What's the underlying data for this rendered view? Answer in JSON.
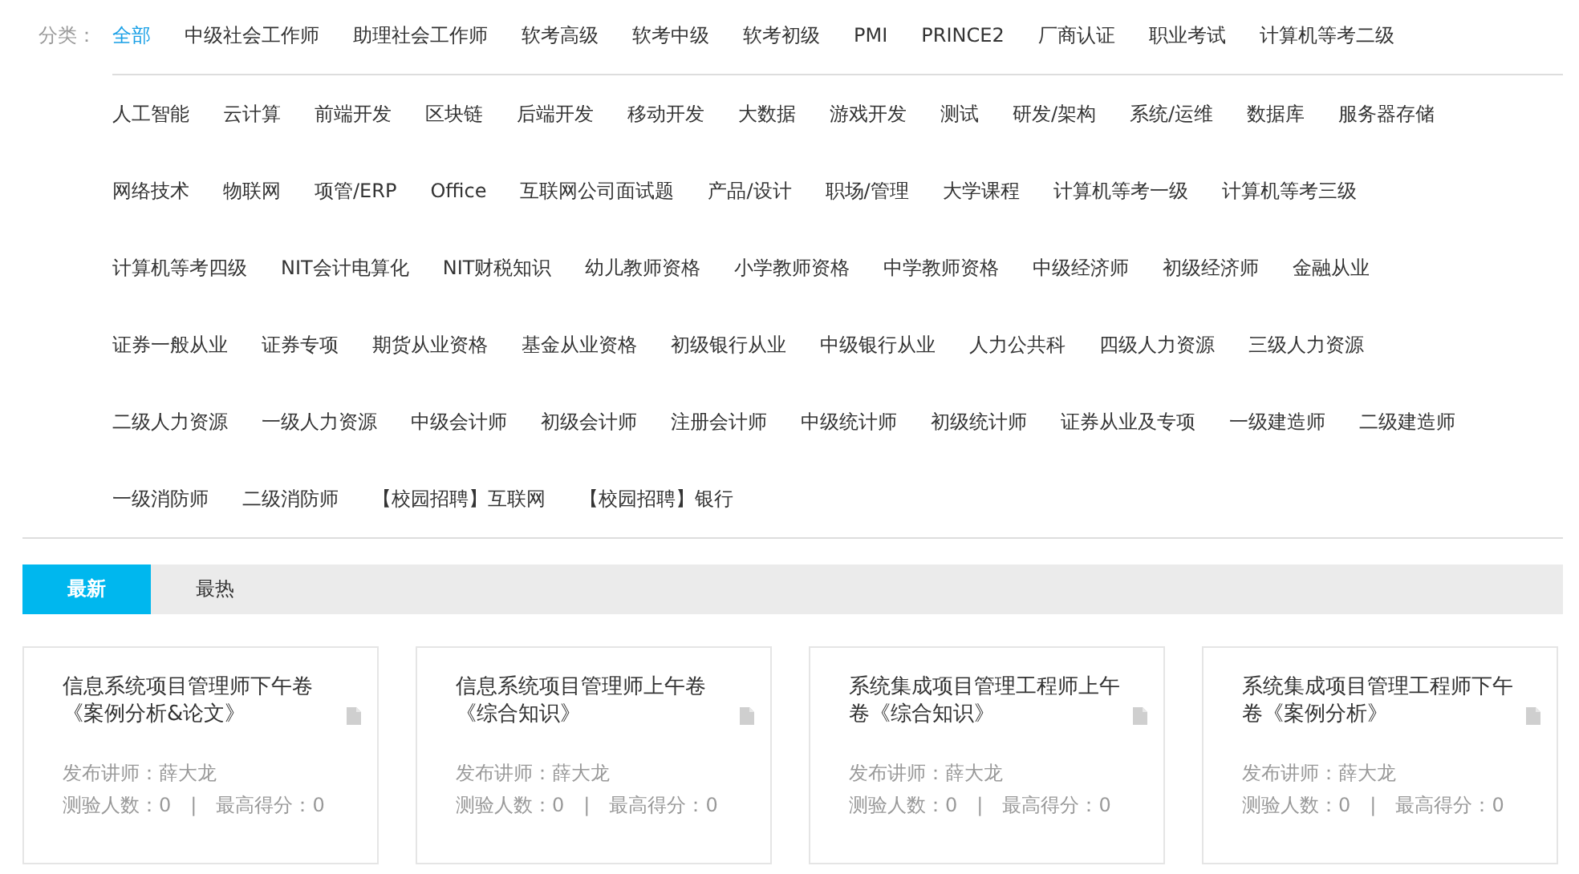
{
  "category_label": "分类：",
  "category_rows": [
    [
      {
        "label": "全部",
        "selected": true
      },
      {
        "label": "中级社会工作师",
        "selected": false
      },
      {
        "label": "助理社会工作师",
        "selected": false
      },
      {
        "label": "软考高级",
        "selected": false
      },
      {
        "label": "软考中级",
        "selected": false
      },
      {
        "label": "软考初级",
        "selected": false
      },
      {
        "label": "PMI",
        "selected": false
      },
      {
        "label": "PRINCE2",
        "selected": false
      },
      {
        "label": "厂商认证",
        "selected": false
      },
      {
        "label": "职业考试",
        "selected": false
      },
      {
        "label": "计算机等考二级",
        "selected": false
      }
    ],
    [
      {
        "label": "人工智能",
        "selected": false
      },
      {
        "label": "云计算",
        "selected": false
      },
      {
        "label": "前端开发",
        "selected": false
      },
      {
        "label": "区块链",
        "selected": false
      },
      {
        "label": "后端开发",
        "selected": false
      },
      {
        "label": "移动开发",
        "selected": false
      },
      {
        "label": "大数据",
        "selected": false
      },
      {
        "label": "游戏开发",
        "selected": false
      },
      {
        "label": "测试",
        "selected": false
      },
      {
        "label": "研发/架构",
        "selected": false
      },
      {
        "label": "系统/运维",
        "selected": false
      },
      {
        "label": "数据库",
        "selected": false
      },
      {
        "label": "服务器存储",
        "selected": false
      }
    ],
    [
      {
        "label": "网络技术",
        "selected": false
      },
      {
        "label": "物联网",
        "selected": false
      },
      {
        "label": "项管/ERP",
        "selected": false
      },
      {
        "label": "Office",
        "selected": false
      },
      {
        "label": "互联网公司面试题",
        "selected": false
      },
      {
        "label": "产品/设计",
        "selected": false
      },
      {
        "label": "职场/管理",
        "selected": false
      },
      {
        "label": "大学课程",
        "selected": false
      },
      {
        "label": "计算机等考一级",
        "selected": false
      },
      {
        "label": "计算机等考三级",
        "selected": false
      }
    ],
    [
      {
        "label": "计算机等考四级",
        "selected": false
      },
      {
        "label": "NIT会计电算化",
        "selected": false
      },
      {
        "label": "NIT财税知识",
        "selected": false
      },
      {
        "label": "幼儿教师资格",
        "selected": false
      },
      {
        "label": "小学教师资格",
        "selected": false
      },
      {
        "label": "中学教师资格",
        "selected": false
      },
      {
        "label": "中级经济师",
        "selected": false
      },
      {
        "label": "初级经济师",
        "selected": false
      },
      {
        "label": "金融从业",
        "selected": false
      }
    ],
    [
      {
        "label": "证券一般从业",
        "selected": false
      },
      {
        "label": "证券专项",
        "selected": false
      },
      {
        "label": "期货从业资格",
        "selected": false
      },
      {
        "label": "基金从业资格",
        "selected": false
      },
      {
        "label": "初级银行从业",
        "selected": false
      },
      {
        "label": "中级银行从业",
        "selected": false
      },
      {
        "label": "人力公共科",
        "selected": false
      },
      {
        "label": "四级人力资源",
        "selected": false
      },
      {
        "label": "三级人力资源",
        "selected": false
      }
    ],
    [
      {
        "label": "二级人力资源",
        "selected": false
      },
      {
        "label": "一级人力资源",
        "selected": false
      },
      {
        "label": "中级会计师",
        "selected": false
      },
      {
        "label": "初级会计师",
        "selected": false
      },
      {
        "label": "注册会计师",
        "selected": false
      },
      {
        "label": "中级统计师",
        "selected": false
      },
      {
        "label": "初级统计师",
        "selected": false
      },
      {
        "label": "证券从业及专项",
        "selected": false
      },
      {
        "label": "一级建造师",
        "selected": false
      },
      {
        "label": "二级建造师",
        "selected": false
      }
    ],
    [
      {
        "label": "一级消防师",
        "selected": false
      },
      {
        "label": "二级消防师",
        "selected": false
      },
      {
        "label": "【校园招聘】互联网",
        "selected": false
      },
      {
        "label": "【校园招聘】银行",
        "selected": false
      }
    ]
  ],
  "tabs": [
    {
      "label": "最新",
      "selected": true
    },
    {
      "label": "最热",
      "selected": false
    }
  ],
  "cards": [
    {
      "title": "信息系统项目管理师下午卷《案例分析&论文》",
      "lecturer": "发布讲师：薛大龙",
      "takers": "测验人数：0",
      "separator": "|",
      "top_score": "最高得分：0"
    },
    {
      "title": "信息系统项目管理师上午卷《综合知识》",
      "lecturer": "发布讲师：薛大龙",
      "takers": "测验人数：0",
      "separator": "|",
      "top_score": "最高得分：0"
    },
    {
      "title": "系统集成项目管理工程师上午卷《综合知识》",
      "lecturer": "发布讲师：薛大龙",
      "takers": "测验人数：0",
      "separator": "|",
      "top_score": "最高得分：0"
    },
    {
      "title": "系统集成项目管理工程师下午卷《案例分析》",
      "lecturer": "发布讲师：薛大龙",
      "takers": "测验人数：0",
      "separator": "|",
      "top_score": "最高得分：0"
    }
  ]
}
